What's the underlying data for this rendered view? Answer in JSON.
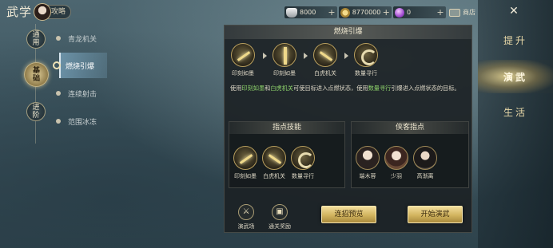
{
  "header": {
    "title": "武学",
    "badge_label": "攻略"
  },
  "categories": [
    {
      "label_top": "通",
      "label_bottom": "用",
      "active": false
    },
    {
      "label_top": "基",
      "label_bottom": "础",
      "active": true
    },
    {
      "label_top": "进",
      "label_bottom": "阶",
      "active": false
    }
  ],
  "skills": [
    {
      "label": "青龙机关",
      "active": false
    },
    {
      "label": "燃烧引爆",
      "active": true
    },
    {
      "label": "连续射击",
      "active": false
    },
    {
      "label": "范围冰冻",
      "active": false
    }
  ],
  "currency": {
    "silver": "8000",
    "coins": "8770000",
    "gems": "0",
    "shop_label": "商店",
    "plus": "+"
  },
  "right_nav": {
    "close_symbol": "✕",
    "tabs": [
      {
        "label": "提升",
        "active": false
      },
      {
        "label": "演武",
        "active": true
      },
      {
        "label": "生活",
        "active": false
      }
    ]
  },
  "panel": {
    "title": "燃烧引爆",
    "combo": [
      {
        "label": "印刻如墨",
        "icon": "ink-strike-icon"
      },
      {
        "label": "印刻如墨",
        "icon": "ink-burst-icon"
      },
      {
        "label": "白虎机关",
        "icon": "tiger-claw-icon"
      },
      {
        "label": "数量寻行",
        "icon": "whirlwind-icon"
      }
    ],
    "description": {
      "p1": "使用",
      "s1": "印刻如墨",
      "p2": "和",
      "s2": "白虎机关",
      "p3": "可使目标进入点燃状态，使用",
      "s3": "数量寻行",
      "p4": "引爆进入点燃状态的目标。"
    },
    "guide_skills": {
      "title": "指点技能",
      "items": [
        {
          "label": "印刻如墨"
        },
        {
          "label": "白虎机关"
        },
        {
          "label": "数量寻行"
        }
      ]
    },
    "guide_heroes": {
      "title": "侠客指点",
      "items": [
        {
          "label": "端木蓉"
        },
        {
          "label": "少羽"
        },
        {
          "label": "高渐离"
        }
      ]
    },
    "bottom_icons": [
      {
        "label": "演武场",
        "glyph": "⚔"
      },
      {
        "label": "通关奖励",
        "glyph": "▣"
      }
    ],
    "buttons": {
      "preview": "连招预览",
      "start": "开始演武"
    }
  }
}
